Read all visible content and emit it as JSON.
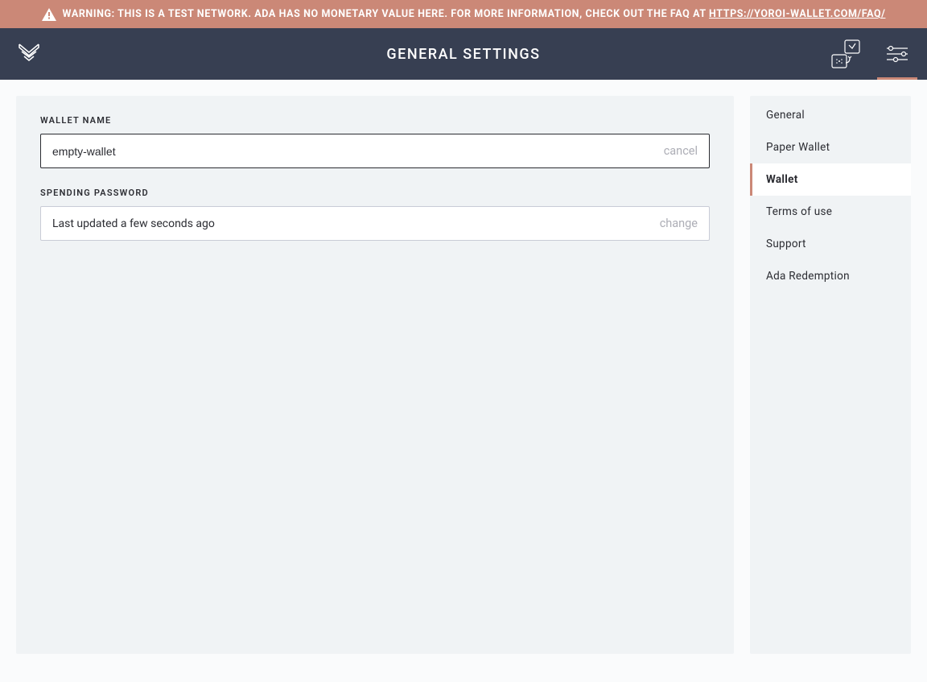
{
  "warning": {
    "text_prefix": "WARNING: THIS IS A TEST NETWORK. ADA HAS NO MONETARY VALUE HERE. FOR MORE INFORMATION, CHECK OUT THE FAQ AT ",
    "faq_link": "HTTPS://YOROI-WALLET.COM/FAQ/"
  },
  "header": {
    "title": "GENERAL SETTINGS"
  },
  "main": {
    "wallet_name": {
      "label": "WALLET NAME",
      "value": "empty-wallet",
      "action": "cancel"
    },
    "spending_password": {
      "label": "SPENDING PASSWORD",
      "status": "Last updated a few seconds ago",
      "action": "change"
    }
  },
  "sidebar": {
    "items": [
      {
        "label": "General",
        "active": false
      },
      {
        "label": "Paper Wallet",
        "active": false
      },
      {
        "label": "Wallet",
        "active": true
      },
      {
        "label": "Terms of use",
        "active": false
      },
      {
        "label": "Support",
        "active": false
      },
      {
        "label": "Ada Redemption",
        "active": false
      }
    ]
  }
}
